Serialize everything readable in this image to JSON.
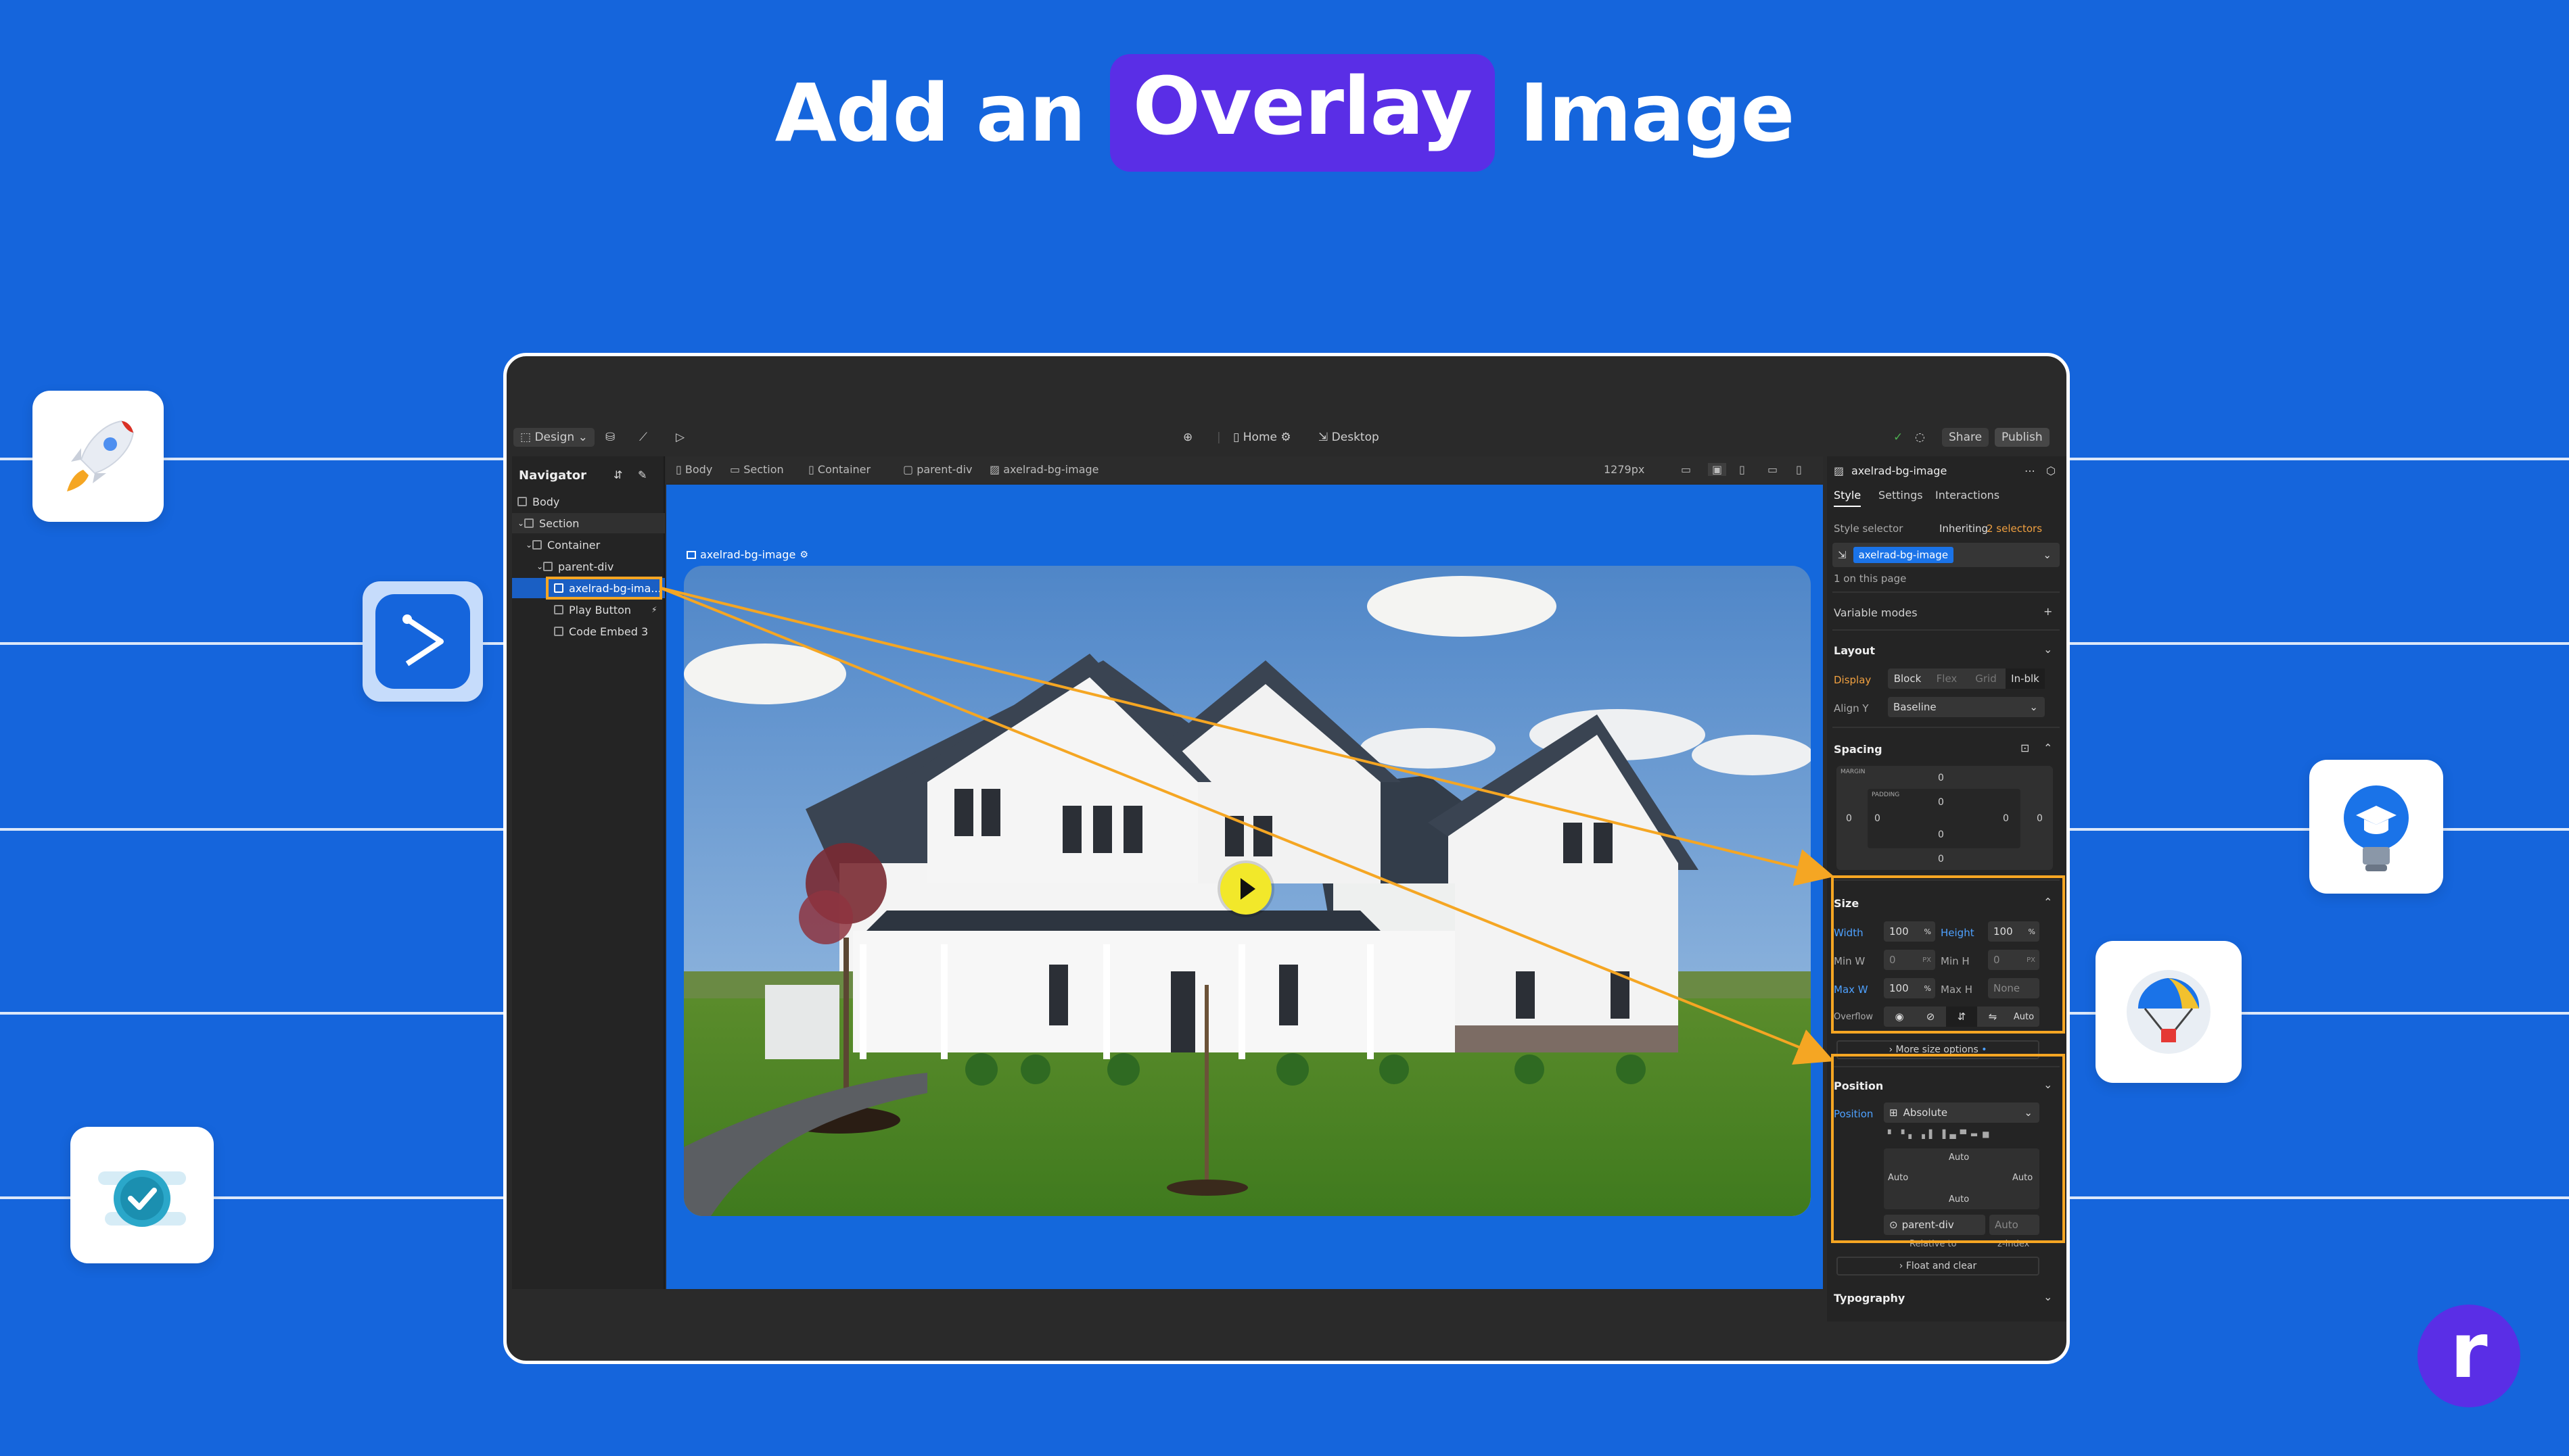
{
  "headline": {
    "pre": "Add an",
    "highlight": "Overlay",
    "post": "Image"
  },
  "colors": {
    "background": "#1565dc",
    "highlight": "#5a2ee6",
    "annotation": "#f5a623",
    "accent": "#1a73e8"
  },
  "topbar": {
    "design_label": "Design",
    "page_label": "Home",
    "breakpoint_label": "Desktop",
    "share_label": "Share",
    "publish_label": "Publish",
    "width_label": "1279px"
  },
  "breadcrumbs": [
    "Body",
    "Section",
    "Container",
    "parent-div",
    "axelrad-bg-image"
  ],
  "navigator": {
    "title": "Navigator",
    "items": [
      {
        "label": "Body"
      },
      {
        "label": "Section"
      },
      {
        "label": "Container"
      },
      {
        "label": "parent-div"
      },
      {
        "label": "axelrad-bg-ima..."
      },
      {
        "label": "Play Button"
      },
      {
        "label": "Code Embed 3"
      }
    ]
  },
  "canvas": {
    "selected_tag": "axelrad-bg-image"
  },
  "panel": {
    "element_name": "axelrad-bg-image",
    "tabs": [
      "Style",
      "Settings",
      "Interactions"
    ],
    "style_selector_label": "Style selector",
    "inheriting_label": "Inheriting",
    "inheriting_count": "2 selectors",
    "selector_chip": "axelrad-bg-image",
    "on_page": "1 on this page",
    "variable_modes": "Variable modes",
    "layout": {
      "title": "Layout",
      "display_label": "Display",
      "display_options": [
        "Block",
        "Flex",
        "Grid",
        "In-blk"
      ],
      "align_label": "Align Y",
      "align_value": "Baseline"
    },
    "spacing": {
      "title": "Spacing",
      "margin_label": "MARGIN",
      "padding_label": "PADDING",
      "values": [
        "0",
        "0",
        "0",
        "0",
        "0",
        "0",
        "0",
        "0"
      ]
    },
    "size": {
      "title": "Size",
      "width_label": "Width",
      "width_value": "100",
      "width_unit": "%",
      "height_label": "Height",
      "height_value": "100",
      "height_unit": "%",
      "minw_label": "Min W",
      "minw_value": "0",
      "minw_unit": "PX",
      "minh_label": "Min H",
      "minh_value": "0",
      "minh_unit": "PX",
      "maxw_label": "Max W",
      "maxw_value": "100",
      "maxw_unit": "%",
      "maxh_label": "Max H",
      "maxh_value": "None",
      "overflow_label": "Overflow",
      "overflow_value": "Auto",
      "more": "More size options"
    },
    "position": {
      "title": "Position",
      "position_label": "Position",
      "position_value": "Absolute",
      "auto_top": "Auto",
      "auto_left": "Auto",
      "auto_right": "Auto",
      "auto_bottom": "Auto",
      "relative_value": "parent-div",
      "relative_label": "Relative to",
      "zindex_value": "Auto",
      "zindex_label": "z-Index",
      "float": "Float and clear"
    },
    "typography": "Typography"
  },
  "brand_letter": "r"
}
